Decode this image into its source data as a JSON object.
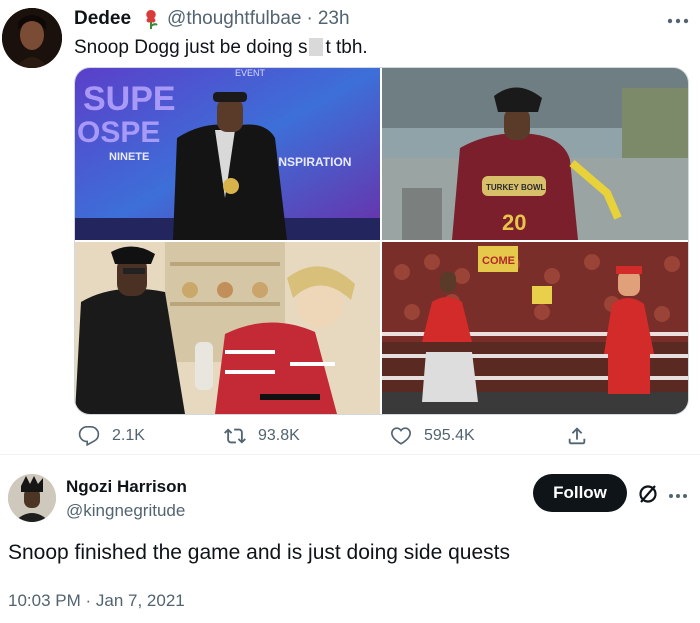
{
  "quoted_tweet": {
    "author_name": "Dedee",
    "author_handle": "@thoughtfulbae",
    "separator": "·",
    "time_ago": "23h",
    "text_before": "Snoop Dogg just be doing s",
    "text_after": "t tbh.",
    "more_icon": "ellipsis-icon",
    "media_images": [
      {
        "signs": [
          "EVENT",
          "SUPE",
          "OSPE",
          "NINETE",
          "INSPIRATION"
        ]
      },
      {
        "jersey_number": "20",
        "sign_text": "TURKEY BOWL"
      },
      {},
      {
        "sign_text": "COME"
      }
    ],
    "actions": {
      "replies": "2.1K",
      "retweets": "93.8K",
      "likes": "595.4K"
    }
  },
  "main_tweet": {
    "author_name": "Ngozi Harrison",
    "author_handle": "@kingnegritude",
    "follow_label": "Follow",
    "text": "Snoop finished the game and is just doing side quests",
    "timestamp": "10:03 PM · Jan 7, 2021"
  },
  "colors": {
    "text_primary": "#0f1419",
    "text_secondary": "#536471",
    "follow_bg": "#0f1419",
    "border": "#cfd9de"
  }
}
